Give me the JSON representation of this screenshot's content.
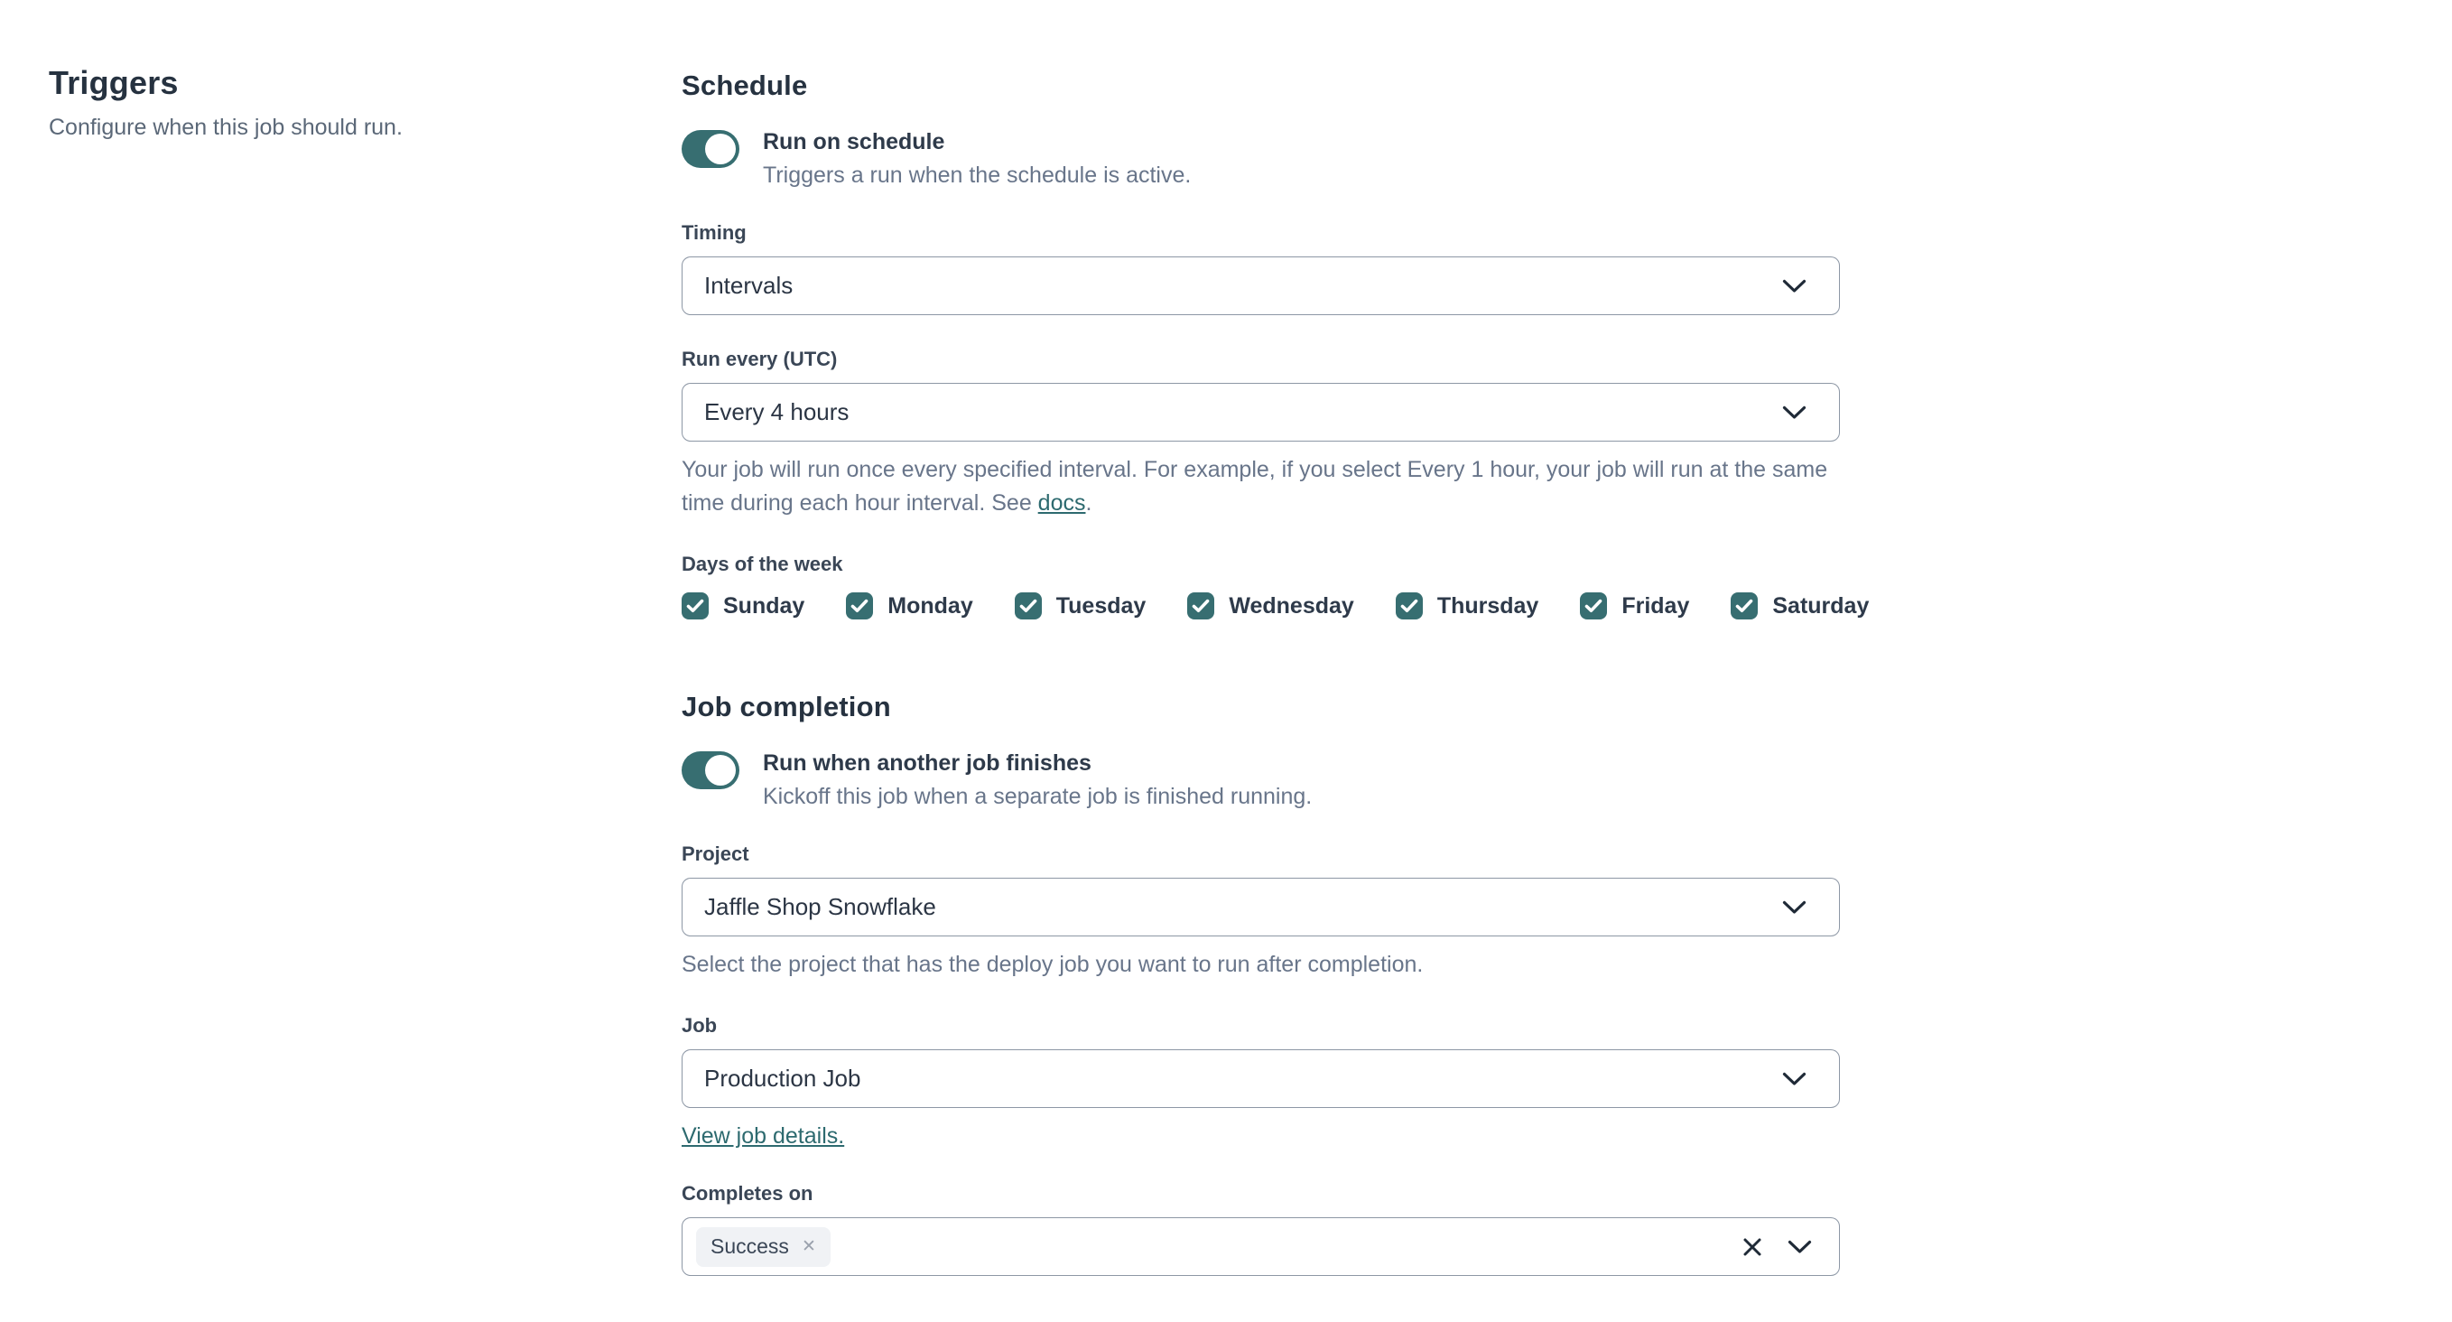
{
  "colors": {
    "accent_teal": "#376e71",
    "link_teal": "#2d6a6f",
    "heading_text": "#263240",
    "secondary_text": "#68758a",
    "border_gray": "#8d97a5",
    "tag_bg": "#f0f2f5"
  },
  "icons": {
    "tag_remove_glyph": "✕",
    "clear_glyph": "✕"
  },
  "left": {
    "title": "Triggers",
    "subtitle": "Configure when this job should run."
  },
  "schedule": {
    "heading": "Schedule",
    "toggle": {
      "label": "Run on schedule",
      "description": "Triggers a run when the schedule is active.",
      "state": "on"
    },
    "timing": {
      "label": "Timing",
      "value": "Intervals"
    },
    "run_every": {
      "label": "Run every (UTC)",
      "value": "Every 4 hours",
      "help_text": "Your job will run once every specified interval. For example, if you select Every 1 hour, your job will run at the same time during each hour interval. See ",
      "help_link_text": "docs",
      "help_suffix": "."
    },
    "days": {
      "label": "Days of the week",
      "items": [
        {
          "label": "Sunday",
          "checked": true
        },
        {
          "label": "Monday",
          "checked": true
        },
        {
          "label": "Tuesday",
          "checked": true
        },
        {
          "label": "Wednesday",
          "checked": true
        },
        {
          "label": "Thursday",
          "checked": true
        },
        {
          "label": "Friday",
          "checked": true
        },
        {
          "label": "Saturday",
          "checked": true
        }
      ]
    }
  },
  "completion": {
    "heading": "Job completion",
    "toggle": {
      "label": "Run when another job finishes",
      "description": "Kickoff this job when a separate job is finished running.",
      "state": "on"
    },
    "project": {
      "label": "Project",
      "value": "Jaffle Shop Snowflake",
      "help": "Select the project that has the deploy job you want to run after completion."
    },
    "job": {
      "label": "Job",
      "value": "Production Job",
      "link_text": "View job details."
    },
    "completes_on": {
      "label": "Completes on",
      "tags": [
        {
          "label": "Success"
        }
      ]
    }
  }
}
